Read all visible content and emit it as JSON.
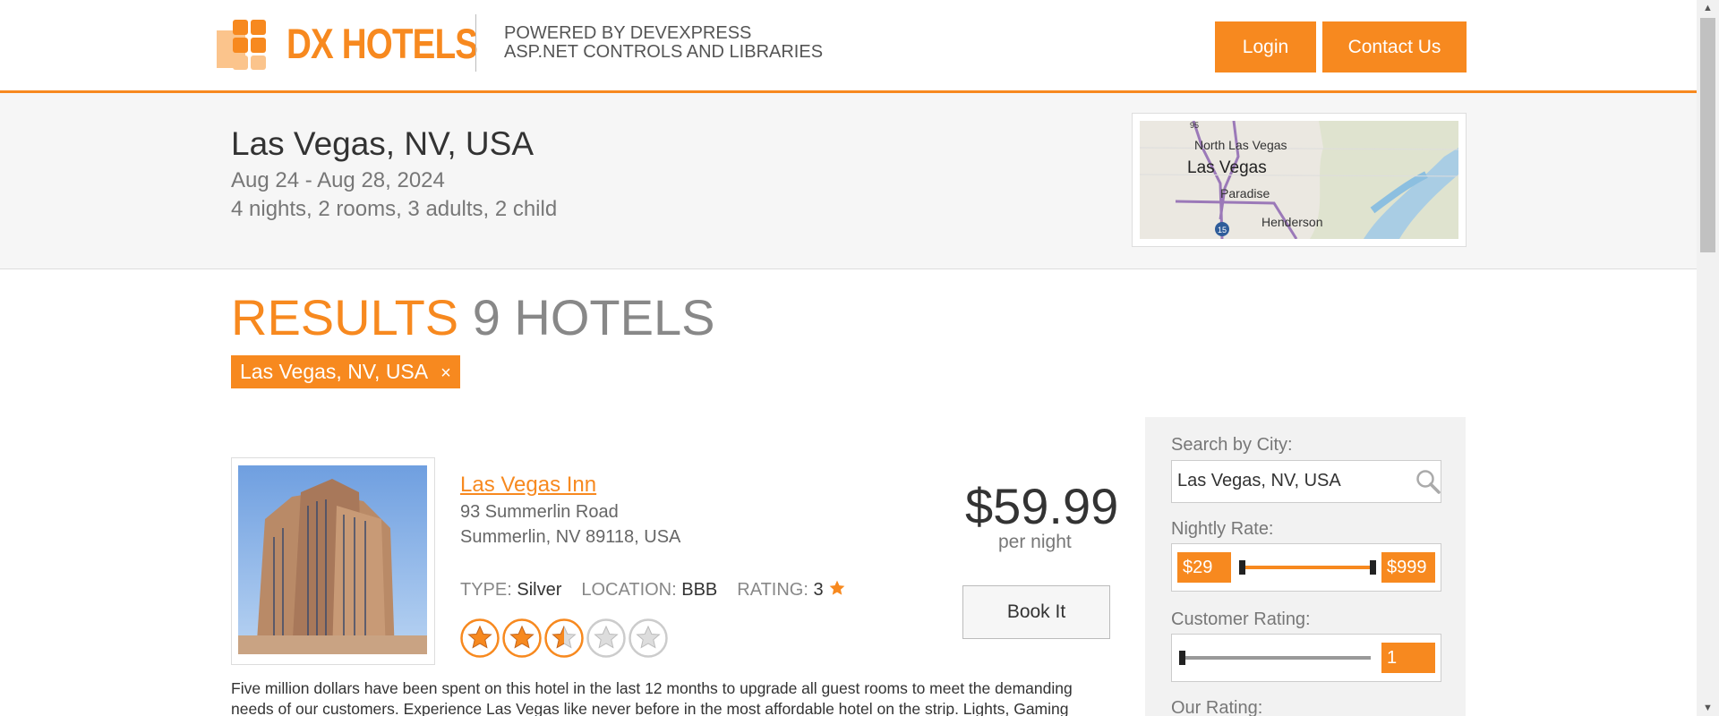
{
  "header": {
    "logo_text": "DX HOTELS",
    "powered_line1": "POWERED BY DEVEXPRESS",
    "powered_line2": "ASP.NET CONTROLS AND LIBRARIES",
    "login_label": "Login",
    "contact_label": "Contact Us"
  },
  "search_summary": {
    "city": "Las Vegas, NV, USA",
    "dates": "Aug 24 - Aug 28, 2024",
    "guests": "4 nights, 2 rooms, 3 adults, 2 child",
    "map_labels": [
      "95",
      "North Las Vegas",
      "Las Vegas",
      "Paradise",
      "Henderson",
      "15"
    ]
  },
  "results": {
    "label": "RESULTS",
    "count": "9 HOTELS",
    "filter_tag": "Las Vegas, NV, USA",
    "filter_tag_remove": "×"
  },
  "hotel": {
    "name": "Las Vegas Inn",
    "address1": "93 Summerlin Road",
    "address2": "Summerlin, NV 89118, USA",
    "type_label": "TYPE:",
    "type_value": "Silver",
    "location_label": "LOCATION:",
    "location_value": "BBB",
    "rating_label": "RATING:",
    "rating_value": "3",
    "star_rating": 2.5,
    "star_max": 5,
    "price": "$59.99",
    "per_night": "per night",
    "book_label": "Book It",
    "description": "Five million dollars have been spent on this hotel in the last 12 months to upgrade all guest rooms to meet the demanding needs of our customers. Experience Las Vegas like never before in the most affordable hotel on the strip. Lights, Gaming"
  },
  "filters": {
    "city_label": "Search by City:",
    "city_value": "Las Vegas, NV, USA",
    "rate_label": "Nightly Rate:",
    "rate_min": "$29",
    "rate_max": "$999",
    "customer_label": "Customer Rating:",
    "customer_value": "1",
    "our_rating_label": "Our Rating:"
  },
  "colors": {
    "accent": "#f7891f",
    "band": "#f6f6f6",
    "panel": "#f2f2f2"
  }
}
